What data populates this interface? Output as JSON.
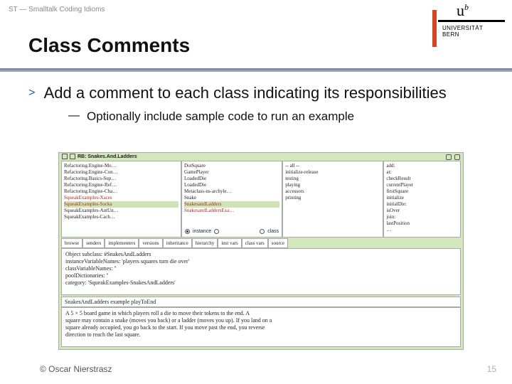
{
  "header": {
    "breadcrumb": "ST — Smalltalk Coding Idioms"
  },
  "logo": {
    "ub": "u",
    "sup": "b",
    "university": "UNIVERSITÄT",
    "city": "BERN"
  },
  "title": "Class Comments",
  "bullet": {
    "marker": ">",
    "text": "Add a comment to each class indicating its responsibilities",
    "sub_marker": "—",
    "sub_text": "Optionally include sample code to run an example"
  },
  "browser": {
    "window_title": "RB: Snakes.And.Ladders",
    "pane1": [
      "Refactoring.Engine-Mo…",
      "Refactoring.Engine-Con…",
      "Refactoring.Basics-Sup…",
      "Refactoring.Engine-Ref…",
      "Refactoring.Engine-Cha…",
      "SqueakExamples-Xaces",
      "SqueakExamples-Socka",
      "SqueakExamples-AntUn…",
      "SqueakExamples-Cach…"
    ],
    "pane1_selected_index": 6,
    "pane2": [
      "DotSquare",
      "GamePlayer",
      "LoadedDie",
      "LoadedDie",
      "Metaclass-ns-archyle…",
      "Snake",
      "SnakesandLadders",
      "SnakesandLaddersExa…"
    ],
    "pane2_selected_index": 6,
    "pane3": [
      "-- all --",
      "initialize-release",
      "testing",
      "playing",
      "accessors",
      "printing",
      ""
    ],
    "pane4": [
      "add:",
      "at:",
      "checkResult",
      "currentPlayer",
      "firstSquare",
      "initialize",
      "initialDie:",
      "isOver",
      "join:",
      "lastPosition",
      "…"
    ],
    "instance_label": "instance",
    "class_label": "class",
    "tabs": [
      "browse",
      "senders",
      "implementers",
      "versions",
      "inheritance",
      "hierarchy",
      "inst vars",
      "class vars",
      "source"
    ],
    "code_lines": [
      "Object subclass: #SnakesAndLadders",
      "    instanceVariableNames: 'players squares turn die over'",
      "    classVariableNames: ''",
      "    poolDictionaries: ''",
      "    category: 'SqueakExamples-SnakesAndLadders'"
    ],
    "second_title": "SnakesAndLadders example playToEnd",
    "description_lines": [
      "A 5 × 5 board game in which players roll a die to move their tokens to the end. A",
      "square may contain a snake (moves you back) or a ladder (moves you up). If you land on a",
      "square already occupied, you go back to the start. If you move past the end, you reverse",
      "direction to reach the last square."
    ]
  },
  "footer": {
    "copyright": "© Oscar Nierstrasz",
    "page": "15"
  }
}
